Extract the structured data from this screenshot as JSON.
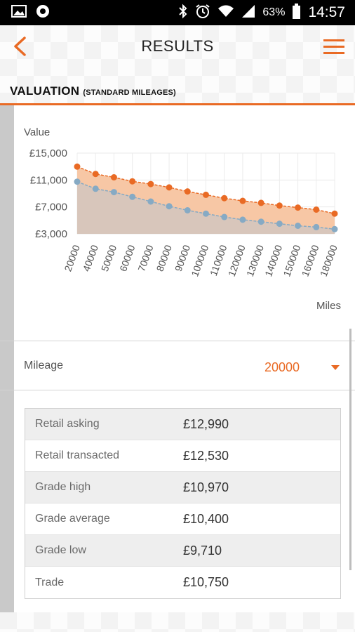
{
  "status_bar": {
    "battery_percent": "63%",
    "time": "14:57",
    "icons": [
      "image-icon",
      "app-icon",
      "bluetooth-icon",
      "alarm-icon",
      "wifi-icon",
      "signal-icon",
      "battery-icon"
    ]
  },
  "header": {
    "title": "RESULTS",
    "section_title": "VALUATION",
    "section_subtitle": "(STANDARD MILEAGES)",
    "accent_color": "#e96a24"
  },
  "chart_data": {
    "type": "area",
    "ylabel": "Value",
    "xlabel": "Miles",
    "y_ticks": [
      "£15,000",
      "£11,000",
      "£7,000",
      "£3,000"
    ],
    "ylim": [
      3000,
      15000
    ],
    "categories": [
      "20000",
      "40000",
      "50000",
      "60000",
      "70000",
      "80000",
      "90000",
      "100000",
      "110000",
      "120000",
      "130000",
      "140000",
      "150000",
      "160000",
      "180000"
    ],
    "series": [
      {
        "color": "#e96a24",
        "fill": "#f7c7a5",
        "values": [
          12990,
          11900,
          11400,
          10800,
          10400,
          9900,
          9300,
          8800,
          8300,
          7900,
          7600,
          7200,
          6900,
          6600,
          6000
        ]
      },
      {
        "color": "#86aac4",
        "fill": "#d8c6bb",
        "values": [
          10750,
          9700,
          9200,
          8500,
          7800,
          7100,
          6500,
          6000,
          5500,
          5100,
          4800,
          4500,
          4200,
          4000,
          3700
        ]
      }
    ],
    "grid": true
  },
  "mileage": {
    "label": "Mileage",
    "selected": "20000"
  },
  "valuation_rows": [
    {
      "label": "Retail asking",
      "value": "£12,990"
    },
    {
      "label": "Retail transacted",
      "value": "£12,530"
    },
    {
      "label": "Grade high",
      "value": "£10,970"
    },
    {
      "label": "Grade average",
      "value": "£10,400"
    },
    {
      "label": "Grade low",
      "value": "£9,710"
    },
    {
      "label": "Trade",
      "value": "£10,750"
    }
  ]
}
